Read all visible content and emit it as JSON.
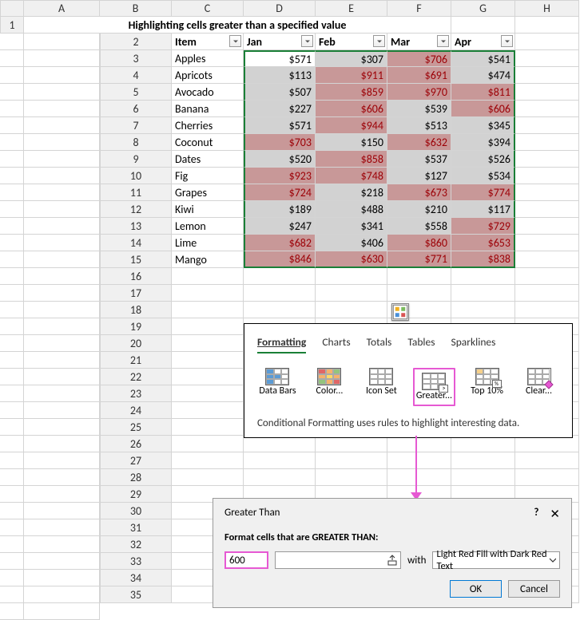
{
  "columns": [
    "A",
    "B",
    "C",
    "D",
    "E",
    "F",
    "G",
    "H"
  ],
  "title": "Highlighting cells greater than a specified value",
  "headers": {
    "item": "Item",
    "months": [
      "Jan",
      "Feb",
      "Mar",
      "Apr"
    ]
  },
  "rows": [
    {
      "item": "Apples",
      "vals": [
        571,
        307,
        706,
        541
      ]
    },
    {
      "item": "Apricots",
      "vals": [
        113,
        911,
        691,
        474
      ]
    },
    {
      "item": "Avocado",
      "vals": [
        507,
        859,
        970,
        811
      ]
    },
    {
      "item": "Banana",
      "vals": [
        227,
        606,
        539,
        606
      ]
    },
    {
      "item": "Cherries",
      "vals": [
        571,
        944,
        513,
        345
      ]
    },
    {
      "item": "Coconut",
      "vals": [
        703,
        150,
        632,
        394
      ]
    },
    {
      "item": "Dates",
      "vals": [
        520,
        858,
        537,
        526
      ]
    },
    {
      "item": "Fig",
      "vals": [
        923,
        748,
        127,
        534
      ]
    },
    {
      "item": "Grapes",
      "vals": [
        724,
        218,
        673,
        774
      ]
    },
    {
      "item": "Kiwi",
      "vals": [
        189,
        488,
        210,
        117
      ]
    },
    {
      "item": "Lemon",
      "vals": [
        247,
        341,
        558,
        729
      ]
    },
    {
      "item": "Lime",
      "vals": [
        682,
        406,
        860,
        653
      ]
    },
    {
      "item": "Mango",
      "vals": [
        846,
        630,
        771,
        838
      ]
    }
  ],
  "threshold": 600,
  "qa": {
    "tabs": [
      "Formatting",
      "Charts",
      "Totals",
      "Tables",
      "Sparklines"
    ],
    "items": [
      "Data Bars",
      "Color...",
      "Icon Set",
      "Greater...",
      "Top 10%",
      "Clear..."
    ],
    "desc": "Conditional Formatting uses rules to highlight interesting data."
  },
  "dialog": {
    "title": "Greater Than",
    "label": "Format cells that are GREATER THAN:",
    "value": "600",
    "with": "with",
    "format": "Light Red Fill with Dark Red Text",
    "ok": "OK",
    "cancel": "Cancel"
  }
}
